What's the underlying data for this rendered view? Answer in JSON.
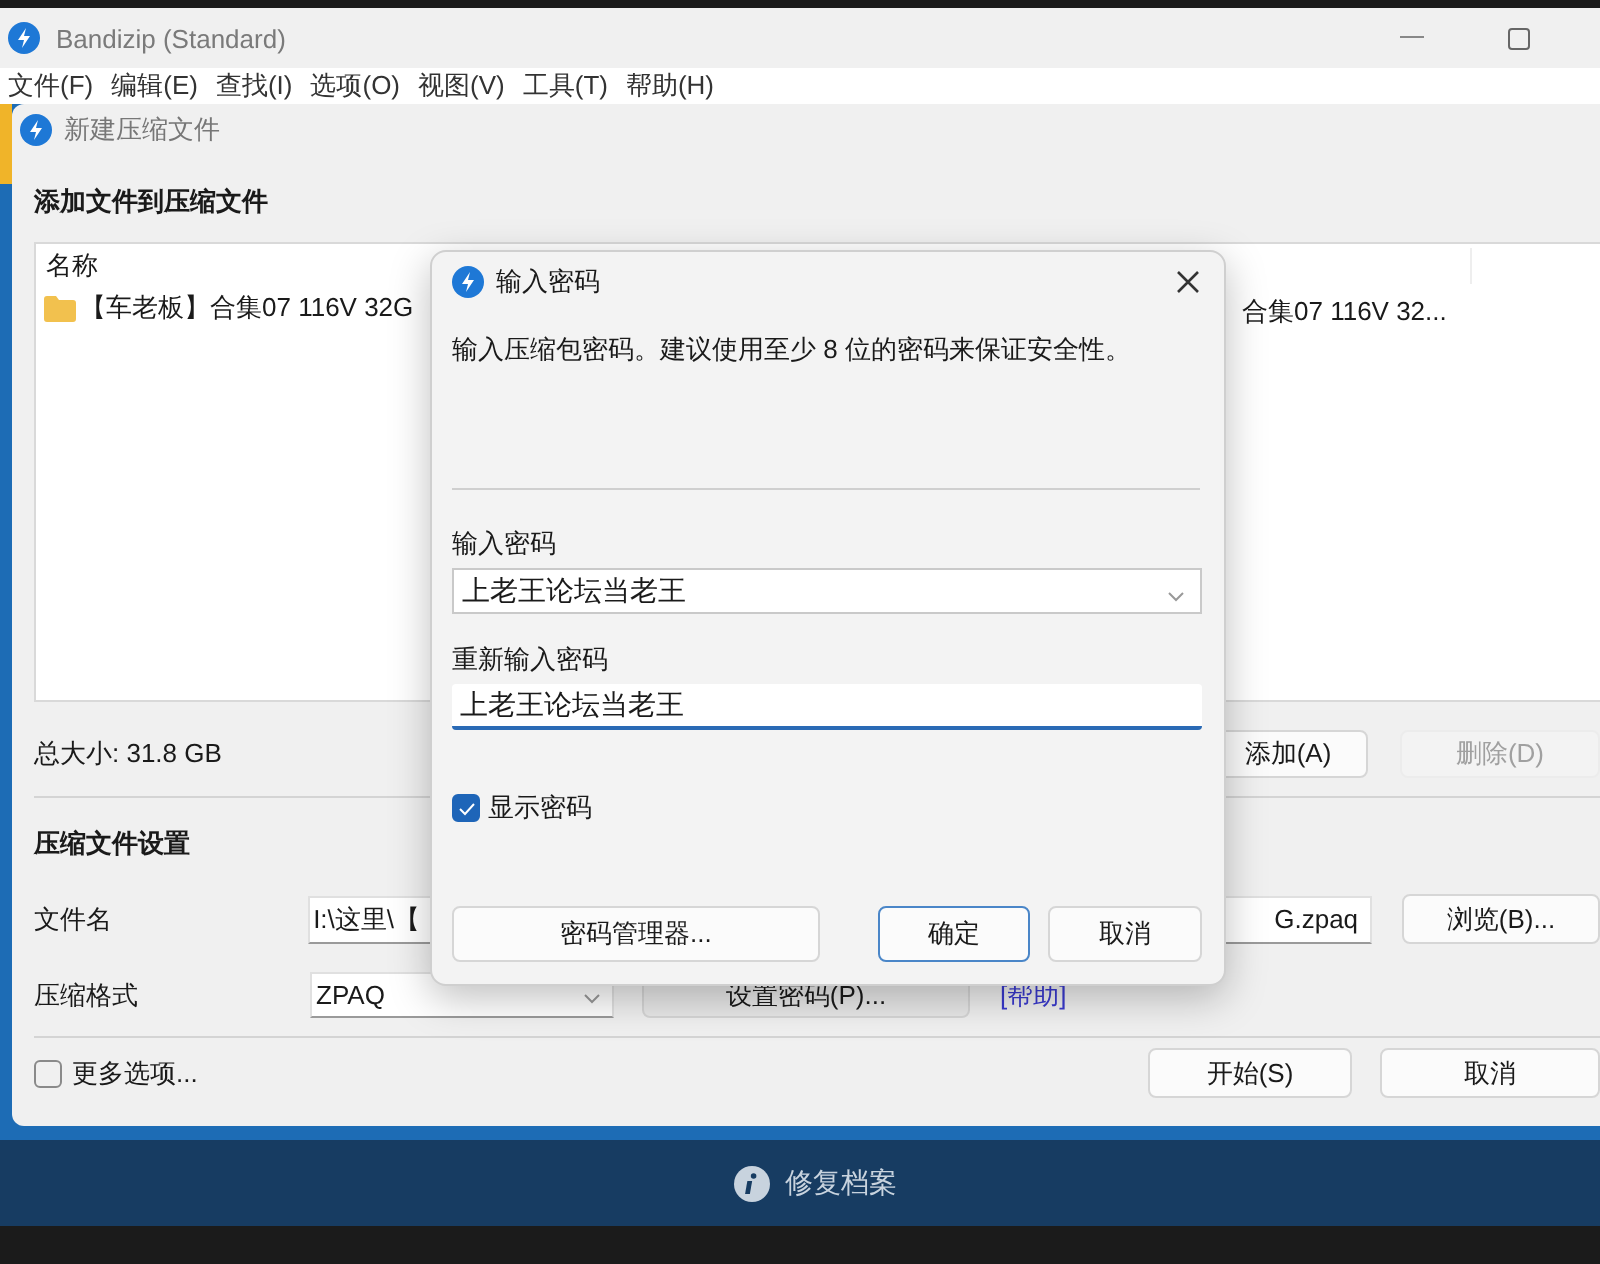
{
  "app_window": {
    "title": "Bandizip (Standard)",
    "menu": [
      "文件(F)",
      "编辑(E)",
      "查找(I)",
      "选项(O)",
      "视图(V)",
      "工具(T)",
      "帮助(H)"
    ]
  },
  "archive_dialog": {
    "title": "新建压缩文件",
    "heading": "添加文件到压缩文件",
    "file_list": {
      "columns": [
        "名称"
      ],
      "rows": [
        {
          "kind": "folder",
          "cells": [
            "【车老板】合集07 116V 32G",
            "合集07 116V 32..."
          ]
        }
      ]
    },
    "total_size": "总大小: 31.8 GB",
    "list_buttons": [
      {
        "label": "添加(A)",
        "disabled": false
      },
      {
        "label": "删除(D)",
        "disabled": true
      }
    ],
    "settings_heading": "压缩文件设置",
    "file_name": {
      "label": "文件名",
      "value_start": "I:\\这里\\【",
      "value_end": "G.zpaq",
      "browse_button": "浏览(B)..."
    },
    "format": {
      "label": "压缩格式",
      "value": "ZPAQ",
      "password_button": "设置密码(P)...",
      "help_link": "[帮助]"
    },
    "more_options": {
      "label": "更多选项...",
      "checked": false
    },
    "buttons": [
      "开始(S)",
      "取消"
    ]
  },
  "password_dialog": {
    "title": "输入密码",
    "description": "输入压缩包密码。建议使用至少 8 位的密码来保证安全性。",
    "password": {
      "label": "输入密码",
      "value": "上老王论坛当老王"
    },
    "confirm": {
      "label": "重新输入密码",
      "value": "上老王论坛当老王"
    },
    "show_password": {
      "label": "显示密码",
      "checked": true
    },
    "buttons": [
      {
        "label": "密码管理器...",
        "kind": "normal"
      },
      {
        "label": "确定",
        "kind": "default"
      },
      {
        "label": "取消",
        "kind": "normal"
      }
    ]
  },
  "taskbar": {
    "label": "修复档案"
  }
}
